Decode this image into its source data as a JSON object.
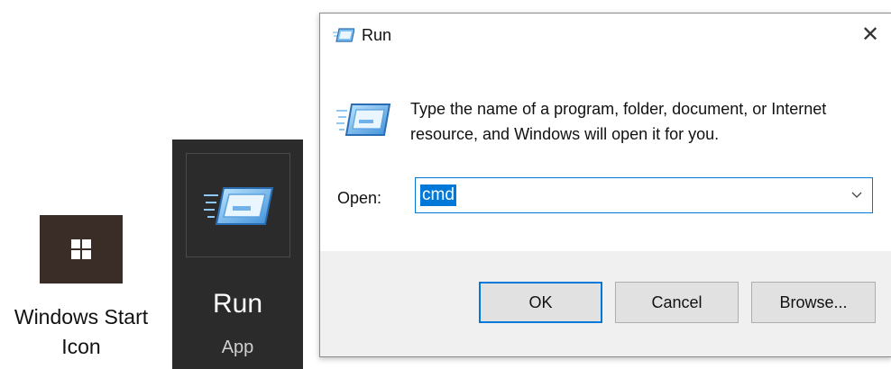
{
  "start_tile": {
    "caption_line1": "Windows Start",
    "caption_line2": "Icon",
    "icon": "windows-logo-icon"
  },
  "run_tile": {
    "name": "Run",
    "subtitle": "App",
    "icon": "run-icon"
  },
  "dialog": {
    "title": "Run",
    "close_glyph": "✕",
    "description": "Type the name of a program, folder, document, or Internet resource, and Windows will open it for you.",
    "open_label": "Open:",
    "open_value": "cmd",
    "buttons": {
      "ok": "OK",
      "cancel": "Cancel",
      "browse": "Browse..."
    }
  },
  "colors": {
    "accent": "#0078d7",
    "start_tile_bg": "#3a2d28",
    "run_tile_bg": "#2b2b2b",
    "footer_bg": "#f0f0f0"
  }
}
